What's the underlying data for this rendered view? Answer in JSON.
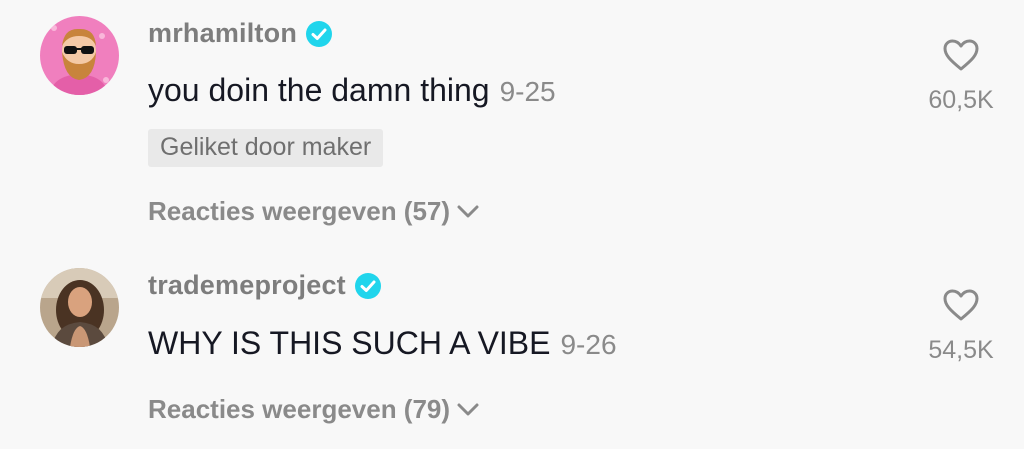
{
  "comments": [
    {
      "username": "mrhamilton",
      "verified": true,
      "text": "you doin the damn thing",
      "date": "9-25",
      "badge": "Geliket door maker",
      "replies_label": "Reacties weergeven (57)",
      "likes": "60,5K",
      "avatar_icon": "cartoon-bearded-man-avatar"
    },
    {
      "username": "trademeproject",
      "verified": true,
      "text": "WHY IS THIS SUCH A VIBE",
      "date": "9-26",
      "replies_label": "Reacties weergeven (79)",
      "likes": "54,5K",
      "avatar_icon": "woman-photo-avatar"
    }
  ],
  "colors": {
    "background": "#f8f8f8",
    "verified_badge": "#20d5ec",
    "text_primary": "#161823",
    "text_secondary": "#8a8a8a"
  }
}
